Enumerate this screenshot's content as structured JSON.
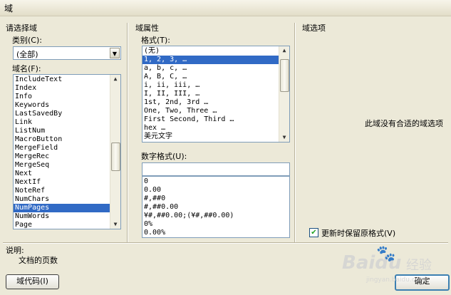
{
  "window": {
    "title": "域"
  },
  "left": {
    "header": "请选择域",
    "category_label": "类别(C):",
    "category_value": "(全部)",
    "fieldname_label": "域名(F):",
    "fields": [
      "IncludeText",
      "Index",
      "Info",
      "Keywords",
      "LastSavedBy",
      "Link",
      "ListNum",
      "MacroButton",
      "MergeField",
      "MergeRec",
      "MergeSeq",
      "Next",
      "NextIf",
      "NoteRef",
      "NumChars",
      "NumPages",
      "NumWords",
      "Page"
    ],
    "selected_index": 15
  },
  "middle": {
    "header": "域属性",
    "format_label": "格式(T):",
    "formats": [
      "(无)",
      "1, 2, 3, …",
      "a, b, c, …",
      "A, B, C, …",
      "i, ii, iii, …",
      "I, II, III, …",
      "1st, 2nd, 3rd …",
      "One, Two, Three …",
      "First Second, Third …",
      "hex …",
      "美元文字"
    ],
    "selected_format_index": 1,
    "number_format_label": "数字格式(U):",
    "number_format_value": "",
    "number_formats": [
      "0",
      "0.00",
      "#,##0",
      "#,##0.00",
      "¥#,##0.00;(¥#,##0.00)",
      "0%",
      "0.00%"
    ]
  },
  "right": {
    "header": "域选项",
    "no_options": "此域没有合适的域选项",
    "preserve_label": "更新时保留原格式(V)",
    "preserve_checked": true
  },
  "description": {
    "label": "说明:",
    "text": "文档的页数"
  },
  "buttons": {
    "field_codes": "域代码(I)",
    "ok": "确定"
  },
  "watermark": {
    "brand": "Baidu",
    "suffix": "经验",
    "url": "jingyan.baidu.com"
  }
}
